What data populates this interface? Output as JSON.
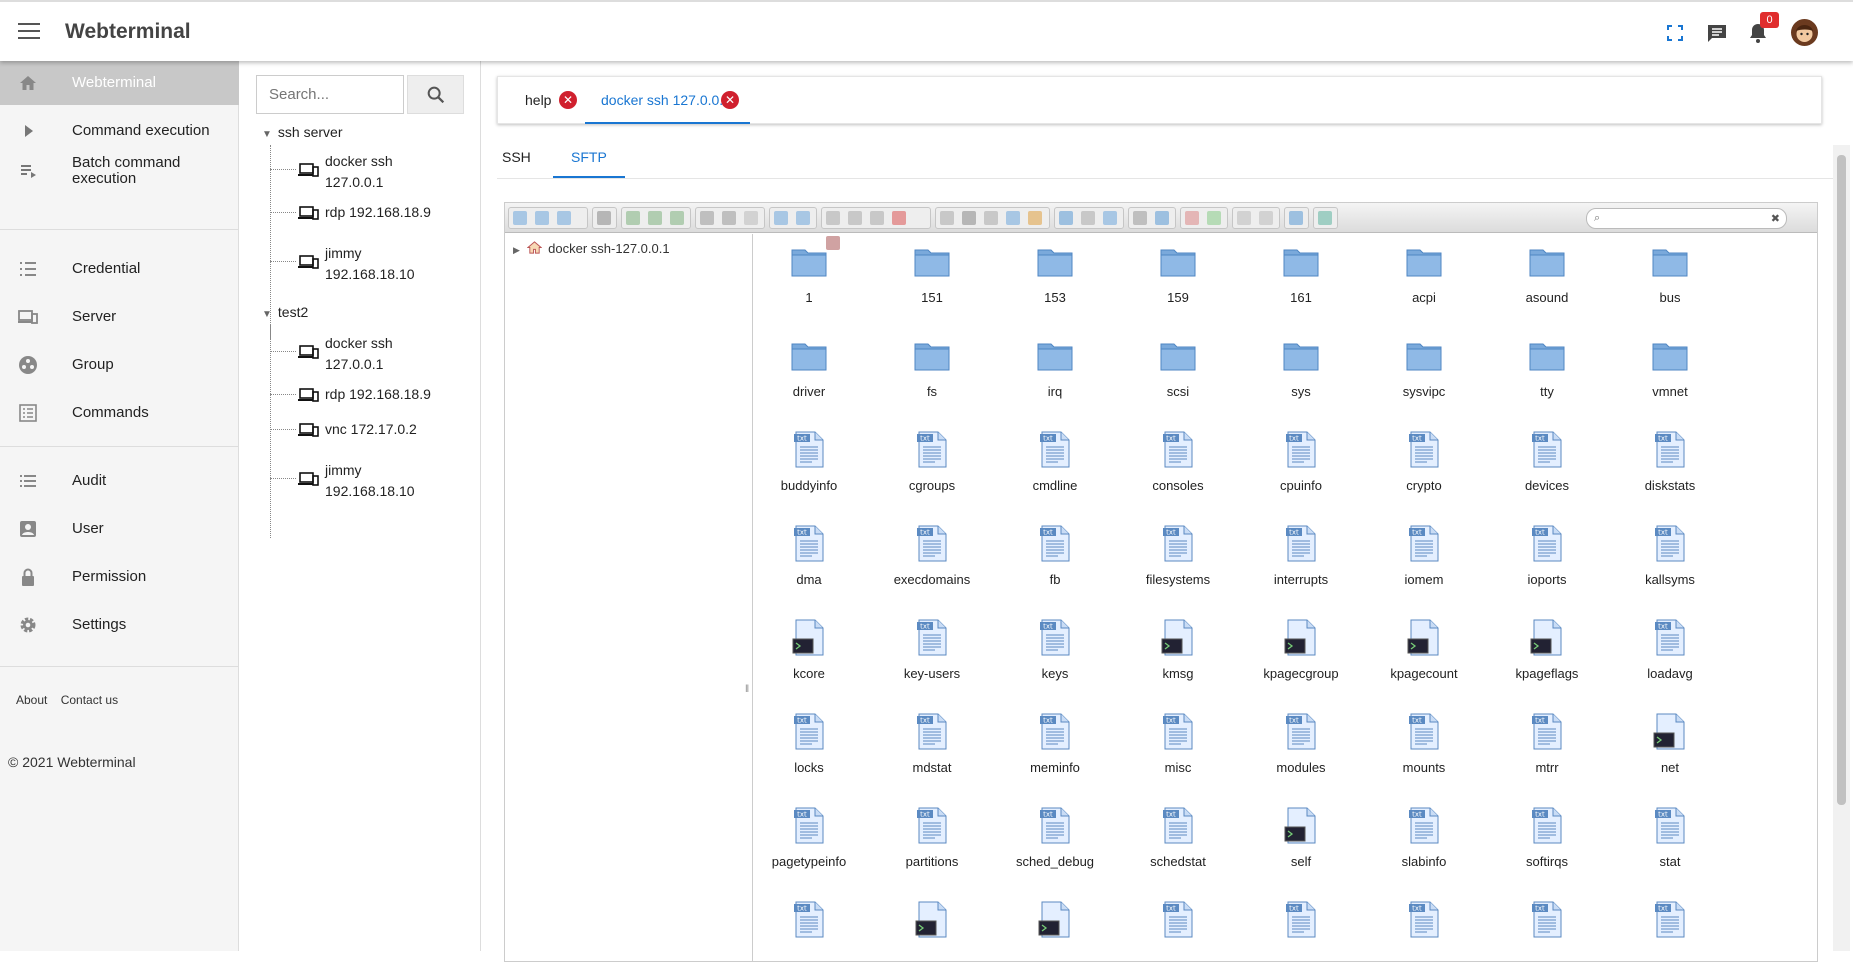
{
  "header": {
    "title": "Webterminal",
    "notification_count": "0",
    "icons": [
      "menu-icon",
      "fullscreen-icon",
      "chat-icon",
      "bell-icon",
      "avatar"
    ]
  },
  "nav": {
    "items": [
      {
        "label": "Webterminal",
        "icon": "home-icon"
      },
      {
        "label": "Command execution",
        "icon": "play-icon"
      },
      {
        "label": "Batch command execution",
        "icon": "playlist-icon"
      },
      {
        "label": "Credential",
        "icon": "list-icon"
      },
      {
        "label": "Server",
        "icon": "devices-icon"
      },
      {
        "label": "Group",
        "icon": "group-icon"
      },
      {
        "label": "Commands",
        "icon": "commands-icon"
      },
      {
        "label": "Audit",
        "icon": "audit-icon"
      },
      {
        "label": "User",
        "icon": "user-icon"
      },
      {
        "label": "Permission",
        "icon": "lock-icon"
      },
      {
        "label": "Settings",
        "icon": "gear-icon"
      }
    ],
    "about": "About",
    "contact": "Contact us",
    "copyright": "© 2021 Webterminal"
  },
  "tree": {
    "search_placeholder": "Search...",
    "groups": [
      {
        "name": "ssh server",
        "items": [
          "docker ssh 127.0.0.1",
          "rdp 192.168.18.9",
          "jimmy 192.168.18.10"
        ]
      },
      {
        "name": "test2",
        "items": [
          "docker ssh 127.0.0.1",
          "rdp 192.168.18.9",
          "vnc 172.17.0.2",
          "jimmy 192.168.18.10"
        ]
      }
    ]
  },
  "tabs": [
    {
      "label": "help",
      "active": false
    },
    {
      "label": "docker ssh 127.0.0.1",
      "active": true
    }
  ],
  "subtabs": [
    {
      "label": "SSH",
      "active": false
    },
    {
      "label": "SFTP",
      "active": true
    }
  ],
  "filemanager": {
    "root": "docker ssh-127.0.0.1",
    "files": [
      {
        "name": "1",
        "type": "folder"
      },
      {
        "name": "151",
        "type": "folder"
      },
      {
        "name": "153",
        "type": "folder"
      },
      {
        "name": "159",
        "type": "folder"
      },
      {
        "name": "161",
        "type": "folder"
      },
      {
        "name": "acpi",
        "type": "folder"
      },
      {
        "name": "asound",
        "type": "folder"
      },
      {
        "name": "bus",
        "type": "folder"
      },
      {
        "name": "driver",
        "type": "folder"
      },
      {
        "name": "fs",
        "type": "folder"
      },
      {
        "name": "irq",
        "type": "folder"
      },
      {
        "name": "scsi",
        "type": "folder"
      },
      {
        "name": "sys",
        "type": "folder"
      },
      {
        "name": "sysvipc",
        "type": "folder"
      },
      {
        "name": "tty",
        "type": "folder"
      },
      {
        "name": "vmnet",
        "type": "folder"
      },
      {
        "name": "buddyinfo",
        "type": "txt"
      },
      {
        "name": "cgroups",
        "type": "txt"
      },
      {
        "name": "cmdline",
        "type": "txt"
      },
      {
        "name": "consoles",
        "type": "txt"
      },
      {
        "name": "cpuinfo",
        "type": "txt"
      },
      {
        "name": "crypto",
        "type": "txt"
      },
      {
        "name": "devices",
        "type": "txt"
      },
      {
        "name": "diskstats",
        "type": "txt"
      },
      {
        "name": "dma",
        "type": "txt"
      },
      {
        "name": "execdomains",
        "type": "txt"
      },
      {
        "name": "fb",
        "type": "txt"
      },
      {
        "name": "filesystems",
        "type": "txt"
      },
      {
        "name": "interrupts",
        "type": "txt"
      },
      {
        "name": "iomem",
        "type": "txt"
      },
      {
        "name": "ioports",
        "type": "txt"
      },
      {
        "name": "kallsyms",
        "type": "txt"
      },
      {
        "name": "kcore",
        "type": "exec"
      },
      {
        "name": "key-users",
        "type": "txt"
      },
      {
        "name": "keys",
        "type": "txt"
      },
      {
        "name": "kmsg",
        "type": "exec"
      },
      {
        "name": "kpagecgroup",
        "type": "exec"
      },
      {
        "name": "kpagecount",
        "type": "exec"
      },
      {
        "name": "kpageflags",
        "type": "exec"
      },
      {
        "name": "loadavg",
        "type": "txt"
      },
      {
        "name": "locks",
        "type": "txt"
      },
      {
        "name": "mdstat",
        "type": "txt"
      },
      {
        "name": "meminfo",
        "type": "txt"
      },
      {
        "name": "misc",
        "type": "txt"
      },
      {
        "name": "modules",
        "type": "txt"
      },
      {
        "name": "mounts",
        "type": "txt"
      },
      {
        "name": "mtrr",
        "type": "txt"
      },
      {
        "name": "net",
        "type": "exec"
      },
      {
        "name": "pagetypeinfo",
        "type": "txt"
      },
      {
        "name": "partitions",
        "type": "txt"
      },
      {
        "name": "sched_debug",
        "type": "txt"
      },
      {
        "name": "schedstat",
        "type": "txt"
      },
      {
        "name": "self",
        "type": "exec"
      },
      {
        "name": "slabinfo",
        "type": "txt"
      },
      {
        "name": "softirqs",
        "type": "txt"
      },
      {
        "name": "stat",
        "type": "txt"
      },
      {
        "name": "",
        "type": "txt"
      },
      {
        "name": "",
        "type": "exec"
      },
      {
        "name": "",
        "type": "exec"
      },
      {
        "name": "",
        "type": "txt"
      },
      {
        "name": "",
        "type": "txt"
      },
      {
        "name": "",
        "type": "txt"
      },
      {
        "name": "",
        "type": "txt"
      },
      {
        "name": "",
        "type": "txt"
      }
    ]
  },
  "colors": {
    "accent": "#1976d2",
    "folder": "#5b9bd5",
    "close": "#d0202e",
    "badge": "#e02d2d"
  }
}
